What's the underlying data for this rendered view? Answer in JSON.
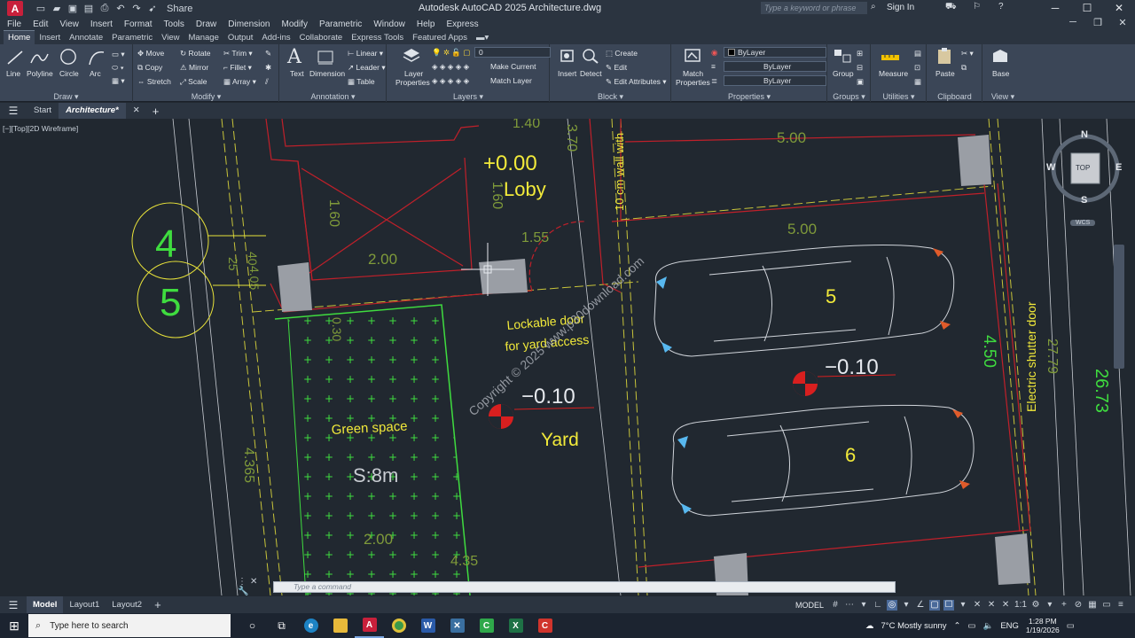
{
  "titlebar": {
    "app_logo": "A",
    "share": "Share",
    "title": "Autodesk AutoCAD 2025   Architecture.dwg",
    "search_placeholder": "Type a keyword or phrase",
    "signin": "Sign In",
    "controls": [
      "─",
      "☐",
      "✕"
    ]
  },
  "menubar": {
    "items": [
      "File",
      "Edit",
      "View",
      "Insert",
      "Format",
      "Tools",
      "Draw",
      "Dimension",
      "Modify",
      "Parametric",
      "Window",
      "Help",
      "Express"
    ],
    "controls": [
      "─",
      "❐",
      "✕"
    ]
  },
  "ribbon_tabs": [
    "Home",
    "Insert",
    "Annotate",
    "Parametric",
    "View",
    "Manage",
    "Output",
    "Add-ins",
    "Collaborate",
    "Express Tools",
    "Featured Apps"
  ],
  "ribbon": {
    "draw": {
      "title": "Draw ▾",
      "line": "Line",
      "polyline": "Polyline",
      "circle": "Circle",
      "arc": "Arc"
    },
    "modify": {
      "title": "Modify ▾",
      "move": "Move",
      "rotate": "Rotate",
      "trim": "Trim",
      "copy": "Copy",
      "mirror": "Mirror",
      "fillet": "Fillet",
      "stretch": "Stretch",
      "scale": "Scale",
      "array": "Array"
    },
    "annotation": {
      "title": "Annotation ▾",
      "text": "Text",
      "dimension": "Dimension",
      "linear": "Linear",
      "leader": "Leader",
      "table": "Table"
    },
    "layers": {
      "title": "Layers ▾",
      "layer_properties_1": "Layer",
      "layer_properties_2": "Properties",
      "layer_value": "0",
      "make_current": "Make Current",
      "match_layer": "Match Layer"
    },
    "block": {
      "title": "Block ▾",
      "insert": "Insert",
      "detect": "Detect",
      "create": "Create",
      "edit": "Edit",
      "edit_attributes": "Edit Attributes"
    },
    "properties": {
      "title": "Properties ▾",
      "match_1": "Match",
      "match_2": "Properties",
      "color": "ByLayer",
      "linetype": "ByLayer",
      "lineweight": "ByLayer"
    },
    "groups": {
      "title": "Groups ▾",
      "group": "Group"
    },
    "utilities": {
      "title": "Utilities ▾",
      "measure": "Measure"
    },
    "clipboard": {
      "title": "Clipboard",
      "paste": "Paste"
    },
    "view": {
      "title": "View ▾",
      "base": "Base"
    }
  },
  "doc_tabs": [
    "Start",
    "Architecture*"
  ],
  "viewport_label": "[−][Top][2D Wireframe]",
  "drawing": {
    "texts": {
      "elev_loby": "+0.00",
      "loby": "Loby",
      "wall": "10 cm wall with",
      "d140": "1.40",
      "d370": "3.70",
      "d160a": "1.60",
      "d160b": "1.60",
      "d200a": "2.00",
      "d155": "1.55",
      "d500a": "5.00",
      "d500b": "5.00",
      "grid4": "4",
      "grid5": "5",
      "d25": "25",
      "d40": "40",
      "d405": "4.05",
      "d030": "0.30",
      "lockable1": "Lockable door",
      "lockable2": "for yard access",
      "copyright": "Copyright © 2025 www.p30download.com",
      "elev_yard": "−0.10",
      "yard": "Yard",
      "green_space": "Green space",
      "s8m": "S:8m",
      "d200b": "2.00",
      "d435": "4.35",
      "d4365": "4.365",
      "elev_park": "−0.10",
      "car5": "5",
      "car6": "6",
      "d450": "4.50",
      "shutter": "Electric shutter door",
      "d2779": "27.79",
      "d2673": "26.73"
    }
  },
  "viewcube": {
    "n": "N",
    "s": "S",
    "e": "E",
    "w": "W",
    "top": "TOP",
    "wcs": "WCS"
  },
  "command": {
    "placeholder": "Type a command"
  },
  "layout_tabs": [
    "Model",
    "Layout1",
    "Layout2"
  ],
  "status": {
    "model": "MODEL",
    "scale": "1:1"
  },
  "taskbar": {
    "search": "Type here to search",
    "weather": "7°C  Mostly sunny",
    "lang": "ENG",
    "time": "1:28 PM",
    "date": "1/19/2026"
  },
  "colors": {
    "canvas": "#212830",
    "ribbon": "#3b4657",
    "yellow_text": "#f2ea3a",
    "dim_green": "#7f9a3a",
    "hatch_green": "#3fdc3f",
    "red_line": "#c0202a",
    "white_line": "#c8ccd2"
  }
}
